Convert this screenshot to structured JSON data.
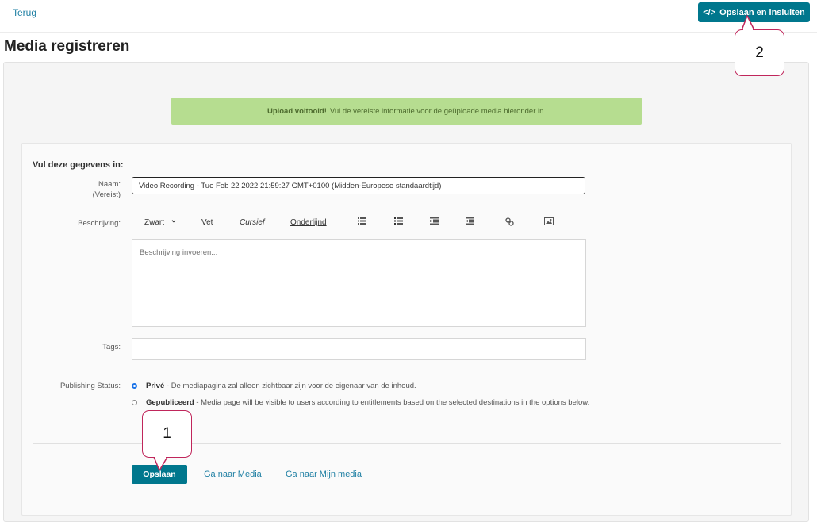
{
  "header": {
    "back_label": "Terug",
    "save_embed_label": "Opslaan en insluiten",
    "code_icon": "</>"
  },
  "page": {
    "title": "Media registreren"
  },
  "alert": {
    "bold": "Upload voltooid!",
    "text": "Vul de vereiste informatie voor de geüploade media hieronder in."
  },
  "form": {
    "heading": "Vul deze gegevens in:",
    "name_label": "Naam:",
    "name_required": "(Vereist)",
    "name_value": "Video Recording - Tue Feb 22 2022 21:59:27 GMT+0100 (Midden-Europese standaardtijd)",
    "description_label": "Beschrijving:",
    "description_placeholder": "Beschrijving invoeren...",
    "toolbar": {
      "color": "Zwart",
      "color_chevron": "⌄",
      "bold": "Vet",
      "italic": "Cursief",
      "underline": "Onderlijnd",
      "icons": [
        "bullet-list-icon",
        "numbered-list-icon",
        "outdent-icon",
        "indent-icon",
        "link-icon",
        "image-icon"
      ]
    },
    "tags_label": "Tags:",
    "publishing_label": "Publishing Status:",
    "publishing_options": [
      {
        "label": "Privé",
        "desc": " - De mediapagina zal alleen zichtbaar zijn voor de eigenaar van de inhoud.",
        "checked": true
      },
      {
        "label": "Gepubliceerd",
        "desc": " - Media page will be visible to users according to entitlements based on the selected destinations in the options below.",
        "checked": false
      }
    ]
  },
  "footer": {
    "save_label": "Opslaan",
    "go_media": "Ga naar Media",
    "go_my_media": "Ga naar Mijn media"
  },
  "callouts": [
    "1",
    "2"
  ],
  "colors": {
    "accent": "#00778d",
    "alert_bg": "#b6dd90",
    "callout_border": "#c0265b",
    "link": "#1e7fa3"
  }
}
